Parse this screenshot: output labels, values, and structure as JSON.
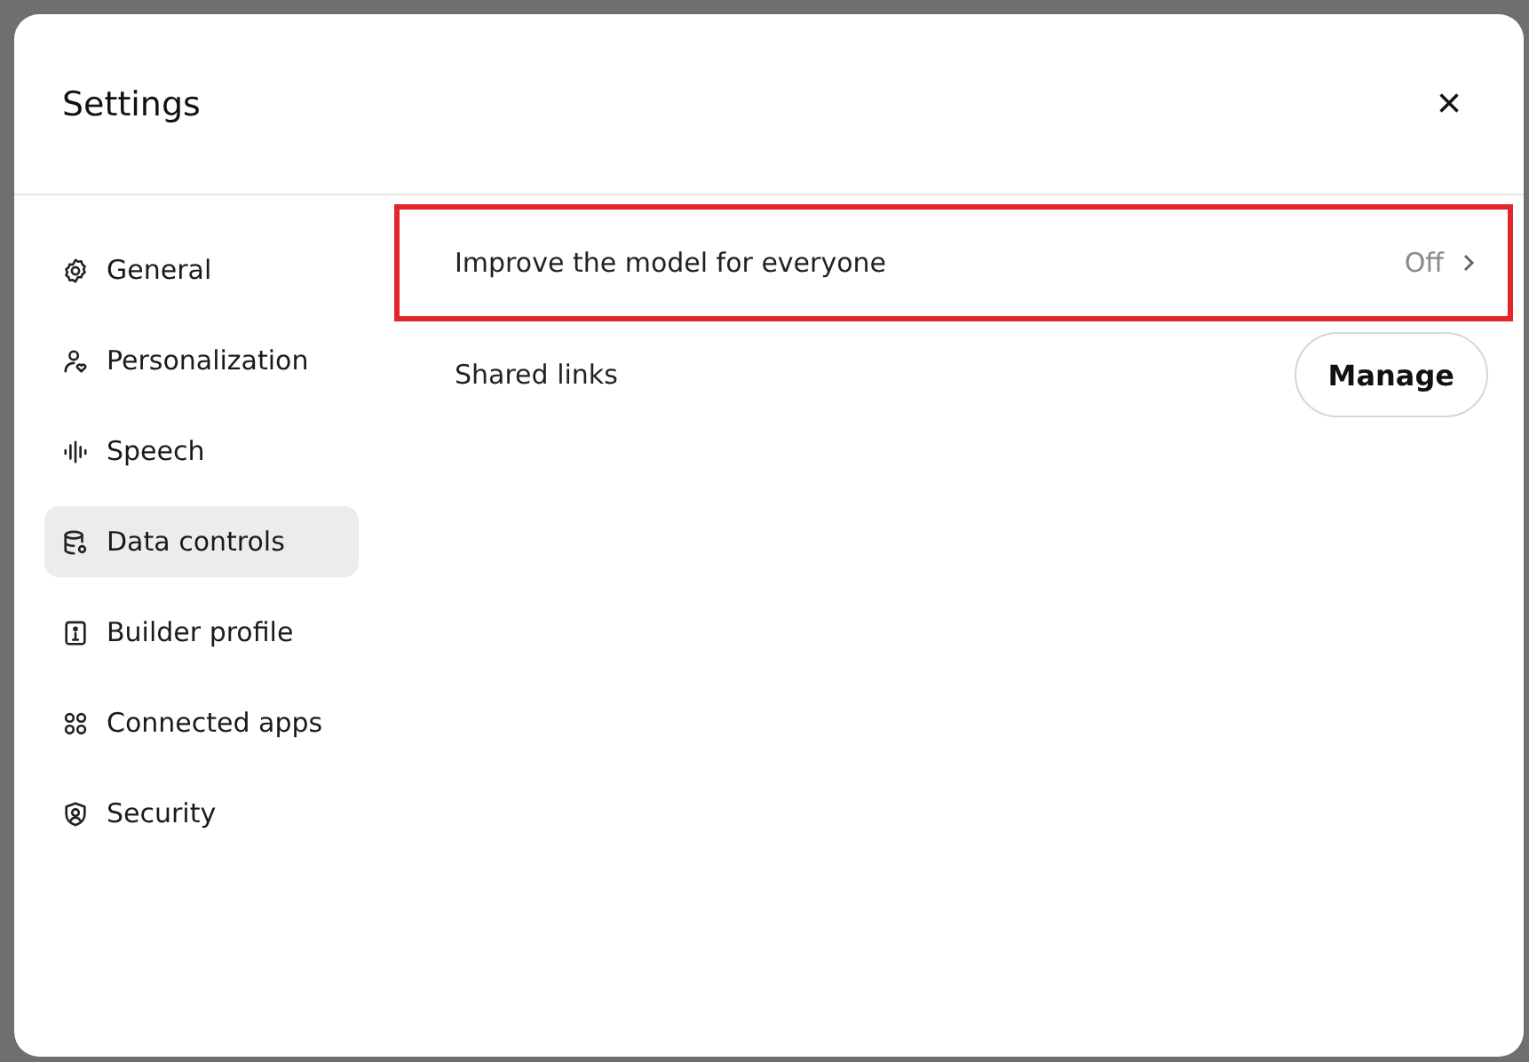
{
  "window": {
    "title": "Settings",
    "close": "×"
  },
  "sidebar": {
    "items": [
      {
        "label": "General",
        "selected": false
      },
      {
        "label": "Personalization",
        "selected": false
      },
      {
        "label": "Speech",
        "selected": false
      },
      {
        "label": "Data controls",
        "selected": true
      },
      {
        "label": "Builder profile",
        "selected": false
      },
      {
        "label": "Connected apps",
        "selected": false
      },
      {
        "label": "Security",
        "selected": false
      }
    ]
  },
  "rows": [
    {
      "kind": "link",
      "label": "Improve the model for everyone",
      "value": "Off",
      "highlighted": true
    },
    {
      "kind": "button",
      "label": "Shared links",
      "button": "Manage",
      "highlighted": false
    }
  ]
}
